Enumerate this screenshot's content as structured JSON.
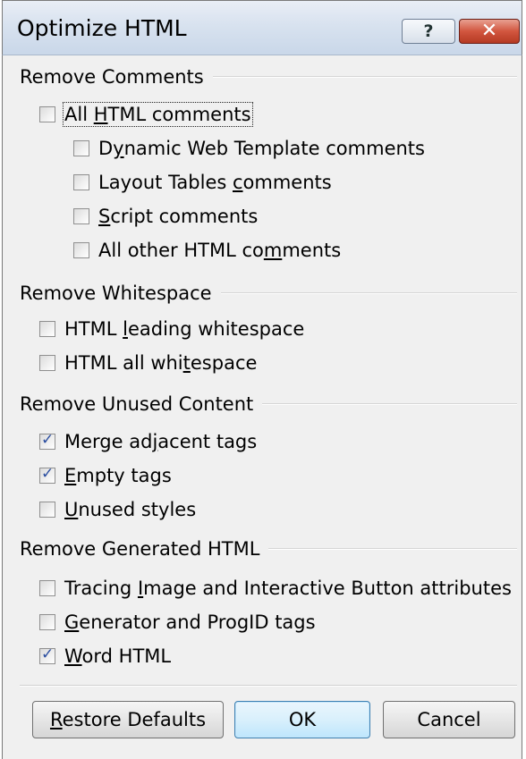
{
  "window": {
    "title": "Optimize HTML",
    "help_label": "?",
    "close_label": "✕"
  },
  "sections": {
    "comments": {
      "title": "Remove Comments",
      "all": {
        "pre": "All ",
        "u": "H",
        "post": "TML comments",
        "checked": false
      },
      "items": [
        {
          "pre": "D",
          "u": "y",
          "post": "namic Web Template comments",
          "checked": false
        },
        {
          "pre": "Layout Tables ",
          "u": "c",
          "post": "omments",
          "checked": false
        },
        {
          "pre": "",
          "u": "S",
          "post": "cript comments",
          "checked": false
        },
        {
          "pre": "All other HTML co",
          "u": "m",
          "post": "ments",
          "checked": false
        }
      ]
    },
    "whitespace": {
      "title": "Remove Whitespace",
      "items": [
        {
          "pre": "HTML ",
          "u": "l",
          "post": "eading whitespace",
          "checked": false
        },
        {
          "pre": "HTML all whi",
          "u": "t",
          "post": "espace",
          "checked": false
        }
      ]
    },
    "unused": {
      "title": "Remove Unused Content",
      "items": [
        {
          "pre": "Merge ad",
          "u": "j",
          "post": "acent tags",
          "checked": true
        },
        {
          "pre": "",
          "u": "E",
          "post": "mpty tags",
          "checked": true
        },
        {
          "pre": "",
          "u": "U",
          "post": "nused styles",
          "checked": false
        }
      ]
    },
    "generated": {
      "title": "Remove Generated HTML",
      "items": [
        {
          "pre": "Tracing ",
          "u": "I",
          "post": "mage and Interactive Button attributes",
          "checked": false
        },
        {
          "pre": "",
          "u": "G",
          "post": "enerator and ProgID tags",
          "checked": false
        },
        {
          "pre": "",
          "u": "W",
          "post": "ord HTML",
          "checked": true
        }
      ]
    }
  },
  "buttons": {
    "restore": {
      "pre": "",
      "u": "R",
      "post": "estore Defaults"
    },
    "ok": "OK",
    "cancel": "Cancel"
  }
}
